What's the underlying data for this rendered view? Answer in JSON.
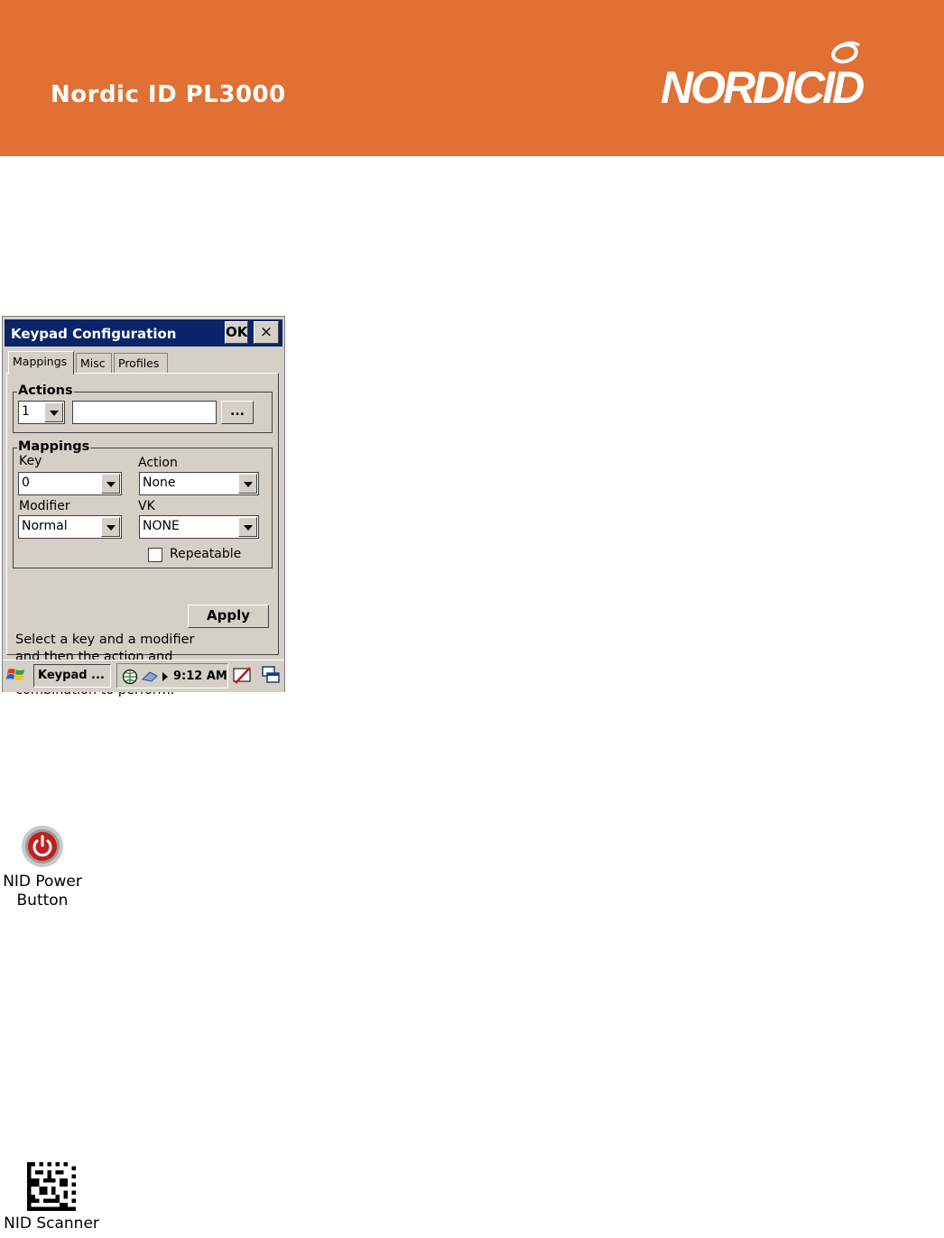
{
  "header": {
    "title": "Nordic ID PL3000",
    "logo_text": "NORDICID",
    "background": "#e07033"
  },
  "device": {
    "window": {
      "title": "Keypad Configuration",
      "ok_label": "OK",
      "close_label": "×"
    },
    "tabs": [
      {
        "label": "Mappings",
        "active": true
      },
      {
        "label": "Misc",
        "active": false
      },
      {
        "label": "Profiles",
        "active": false
      }
    ],
    "actions": {
      "group_label": "Actions",
      "number_value": "1",
      "text_value": "",
      "browse_label": "..."
    },
    "mappings": {
      "group_label": "Mappings",
      "key_label": "Key",
      "key_value": "0",
      "action_label": "Action",
      "action_value": "None",
      "modifier_label": "Modifier",
      "modifier_value": "Normal",
      "vk_label": "VK",
      "vk_value": "NONE",
      "repeatable_label": "Repeatable",
      "repeatable_checked": false
    },
    "help_text": "Select a key and a modifier and then the action and virtual key you want the combination to perform.",
    "apply_label": "Apply",
    "taskbar": {
      "task_label": "Keypad ...",
      "time": "9:12 AM"
    }
  },
  "desktop_icons": [
    {
      "caption_line1": "NID Power",
      "caption_line2": "Button",
      "icon": "power-icon"
    },
    {
      "caption_line1": "NID Scanner",
      "icon": "datamatrix-icon"
    }
  ]
}
